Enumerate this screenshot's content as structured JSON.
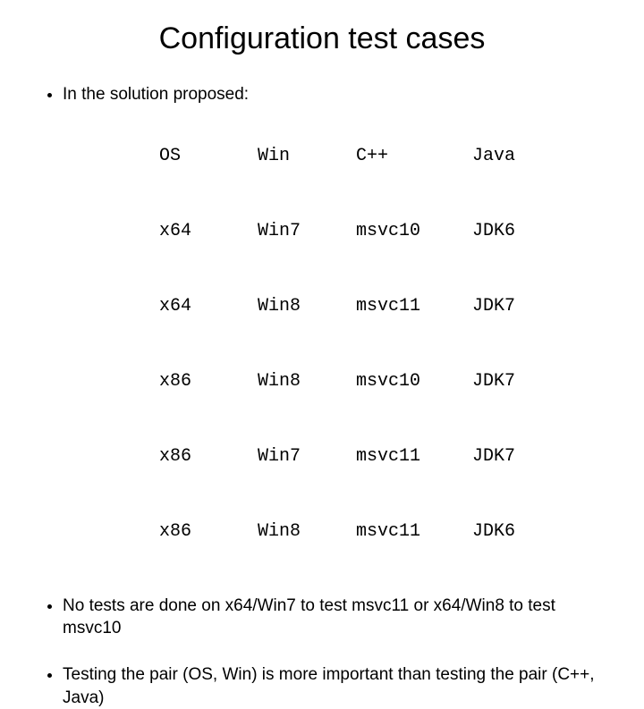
{
  "title": "Configuration test cases",
  "bullet1": "In the solution proposed:",
  "table": {
    "headers": {
      "os": "OS",
      "win": "Win",
      "cpp": "C++",
      "java": "Java"
    },
    "rows": [
      {
        "os": "x64",
        "win": "Win7",
        "cpp": "msvc10",
        "java": "JDK6"
      },
      {
        "os": "x64",
        "win": "Win8",
        "cpp": "msvc11",
        "java": "JDK7"
      },
      {
        "os": "x86",
        "win": "Win8",
        "cpp": "msvc10",
        "java": "JDK7"
      },
      {
        "os": "x86",
        "win": "Win7",
        "cpp": "msvc11",
        "java": "JDK7"
      },
      {
        "os": "x86",
        "win": "Win8",
        "cpp": "msvc11",
        "java": "JDK6"
      }
    ]
  },
  "bullet2": "No tests are done on x64/Win7 to test msvc11 or x64/Win8 to test msvc10",
  "bullet3": "Testing the pair (OS, Win) is more important than testing the pair (C++, Java)"
}
